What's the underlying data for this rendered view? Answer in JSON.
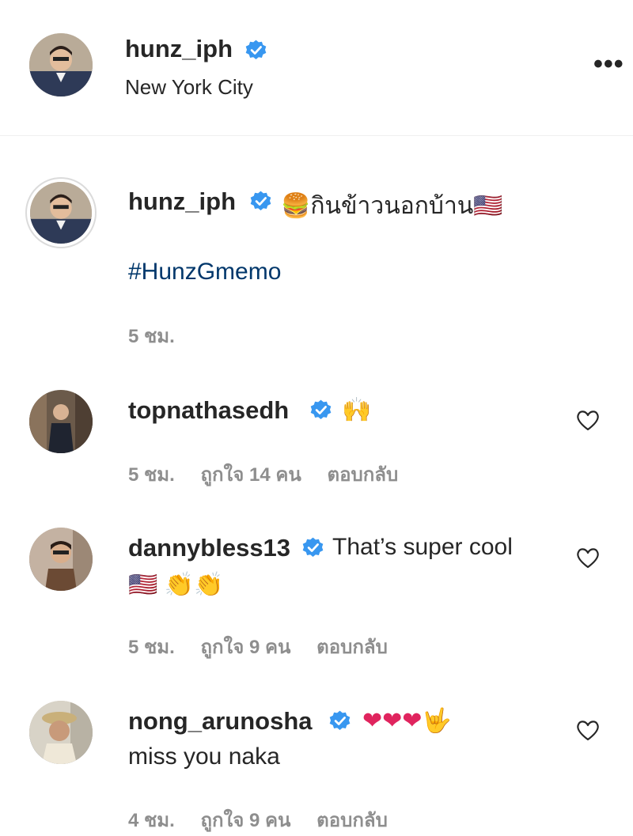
{
  "header": {
    "username": "hunz_iph",
    "location": "New York City",
    "more_label": "•••"
  },
  "caption": {
    "username": "hunz_iph",
    "text": "🍔กินข้าวนอกบ้าน🇺🇸",
    "hashtag": "#HunzGmemo",
    "time": "5 ชม."
  },
  "comments": [
    {
      "username": "topnathasedh",
      "text": "🙌",
      "time": "5 ชม.",
      "likes": "ถูกใจ 14 คน",
      "reply": "ตอบกลับ"
    },
    {
      "username": "dannybless13",
      "text": "That’s super cool",
      "text2": "🇺🇸 👏👏",
      "time": "5 ชม.",
      "likes": "ถูกใจ 9 คน",
      "reply": "ตอบกลับ"
    },
    {
      "username": "nong_arunosha",
      "text": "❤❤❤🤟",
      "text2": "miss you naka",
      "time": "4 ชม.",
      "likes": "ถูกใจ 9 คน",
      "reply": "ตอบกลับ"
    }
  ],
  "colors": {
    "verified": "#3897f0",
    "hashtag": "#00376b",
    "meta": "#8e8e8e"
  },
  "icons": {
    "verified": "verified-badge-icon",
    "heart": "heart-outline-icon",
    "more": "more-options-icon"
  }
}
